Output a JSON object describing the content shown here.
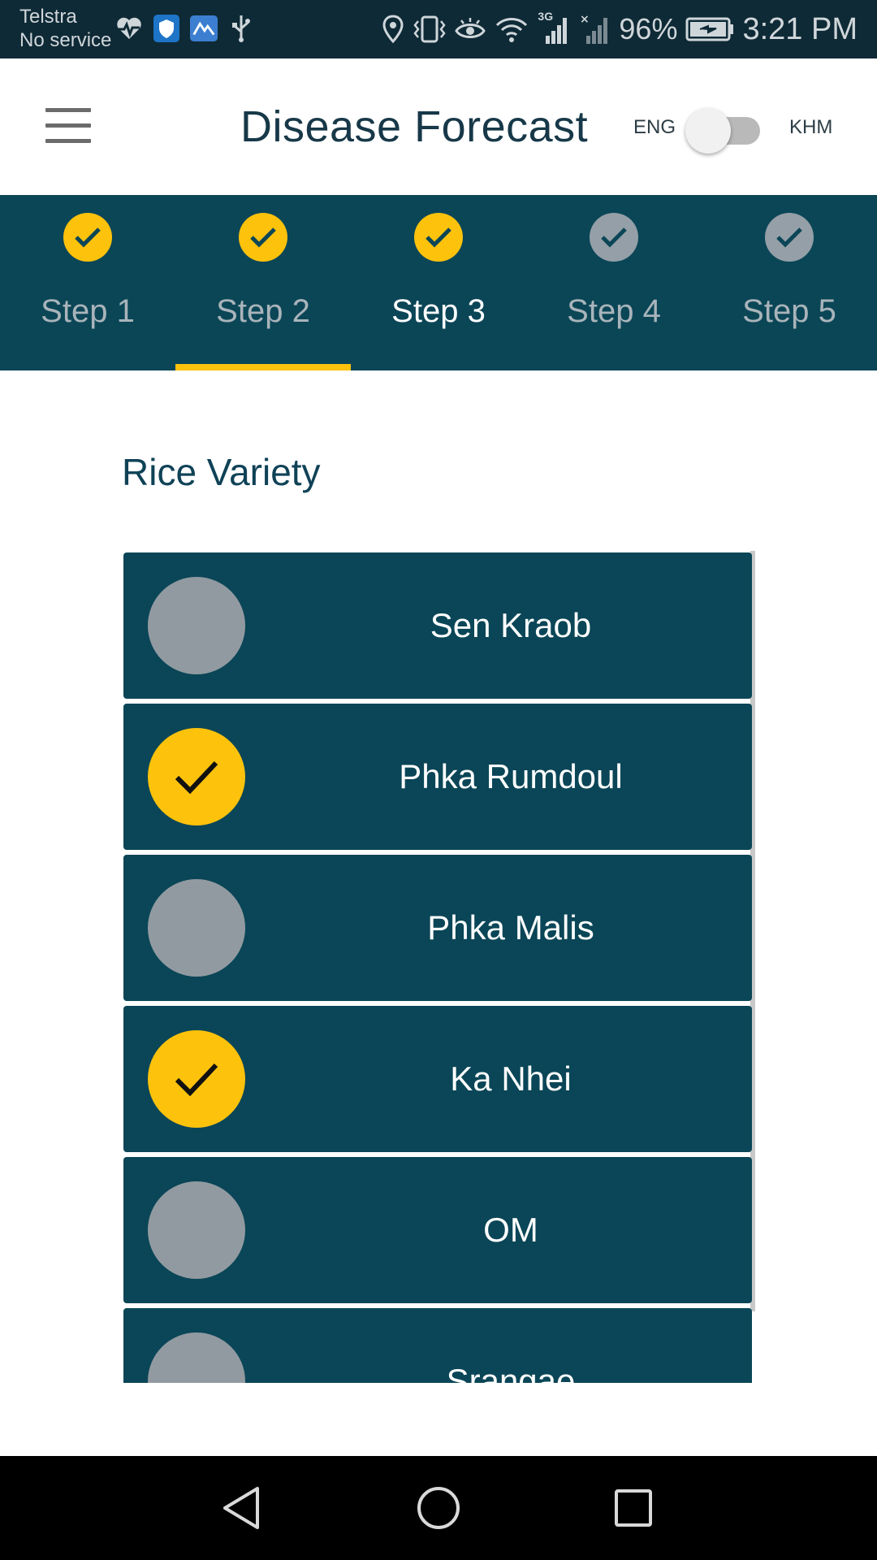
{
  "status_bar": {
    "carrier": "Telstra",
    "service": "No service",
    "battery_percent": "96%",
    "time": "3:21 PM",
    "network_badge": "3G",
    "left_icons": [
      "heartbeat-icon",
      "shield-icon",
      "mountain-app-icon",
      "usb-icon"
    ],
    "right_icons": [
      "location-icon",
      "vibrate-icon",
      "eye-icon",
      "wifi-icon",
      "signal-icon",
      "signal-no-service-icon",
      "battery-charging-icon"
    ]
  },
  "app_bar": {
    "title": "Disease Forecast",
    "lang_left": "ENG",
    "lang_right": "KHM",
    "lang_toggle_on": false
  },
  "stepper": {
    "steps": [
      {
        "label": "Step 1",
        "state": "completed"
      },
      {
        "label": "Step 2",
        "state": "completed"
      },
      {
        "label": "Step 3",
        "state": "active"
      },
      {
        "label": "Step 4",
        "state": "pending"
      },
      {
        "label": "Step 5",
        "state": "pending"
      }
    ],
    "active_index": 2
  },
  "content": {
    "section_title": "Rice Variety",
    "varieties": [
      {
        "name": "Sen Kraob",
        "selected": false
      },
      {
        "name": "Phka Rumdoul",
        "selected": true
      },
      {
        "name": "Phka Malis",
        "selected": false
      },
      {
        "name": "Ka Nhei",
        "selected": true
      },
      {
        "name": "OM",
        "selected": false
      },
      {
        "name": "Srangae",
        "selected": false
      }
    ]
  },
  "colors": {
    "primary": "#0a4657",
    "accent": "#fdc20c",
    "unselected": "#929aa1",
    "status_bar": "#0e2a36"
  },
  "nav_bar": {
    "buttons": [
      "back-icon",
      "home-icon",
      "recents-icon"
    ]
  }
}
